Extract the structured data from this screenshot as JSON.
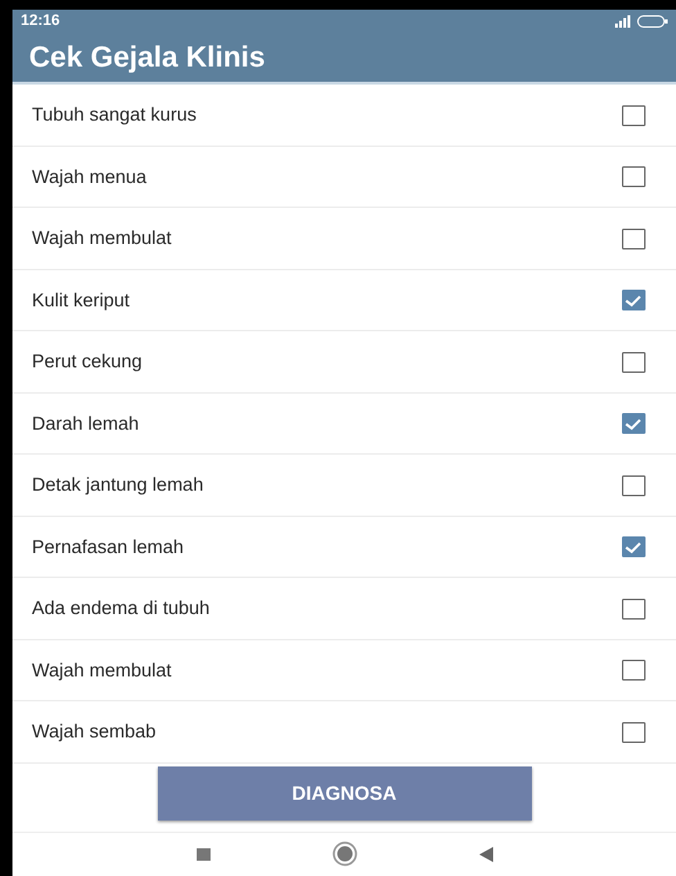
{
  "status_bar": {
    "time": "12:16"
  },
  "app_bar": {
    "title": "Cek Gejala Klinis"
  },
  "symptoms": [
    {
      "label": "Tubuh sangat kurus",
      "checked": false
    },
    {
      "label": "Wajah menua",
      "checked": false
    },
    {
      "label": "Wajah membulat",
      "checked": false
    },
    {
      "label": "Kulit keriput",
      "checked": true
    },
    {
      "label": "Perut cekung",
      "checked": false
    },
    {
      "label": "Darah lemah",
      "checked": true
    },
    {
      "label": "Detak jantung lemah",
      "checked": false
    },
    {
      "label": "Pernafasan lemah",
      "checked": true
    },
    {
      "label": "Ada endema di tubuh",
      "checked": false
    },
    {
      "label": "Wajah membulat",
      "checked": false
    },
    {
      "label": "Wajah sembab",
      "checked": false
    }
  ],
  "button": {
    "label": "DIAGNOSA"
  }
}
